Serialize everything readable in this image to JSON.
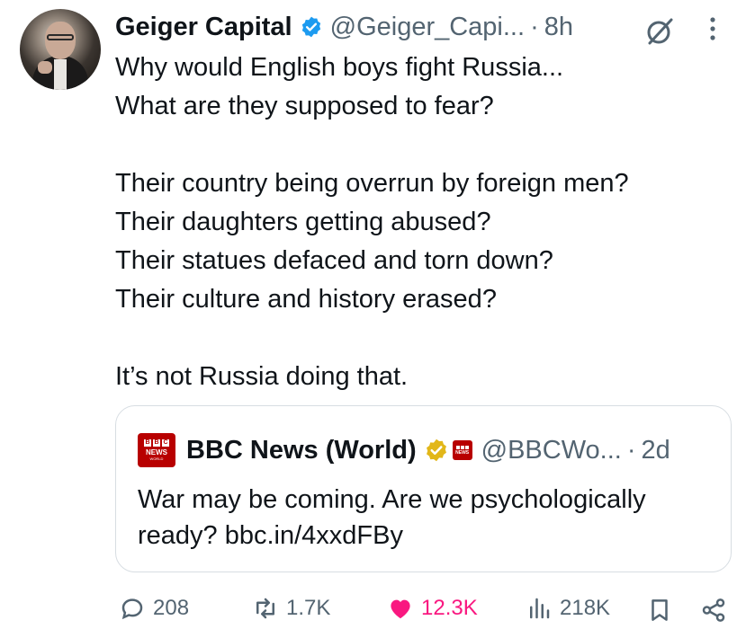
{
  "author": {
    "display_name": "Geiger Capital",
    "handle": "@Geiger_Capi...",
    "separator": "·",
    "time": "8h",
    "avatar_icon": "portrait-avatar",
    "verified_color": "#1d9bf0"
  },
  "tweet": {
    "lines": [
      "Why would English boys fight Russia...",
      "What are they supposed to fear?",
      "",
      "Their country being overrun by foreign men?",
      "Their daughters getting abused?",
      "Their statues defaced and torn down?",
      "Their culture and history erased?",
      "",
      "It’s not Russia doing that."
    ]
  },
  "quote": {
    "logo": {
      "blocks": [
        "B",
        "B",
        "C"
      ],
      "news": "NEWS",
      "world": "WORLD"
    },
    "display_name": "BBC News (World)",
    "handle": "@BBCWo...",
    "separator": "·",
    "time": "2d",
    "text": "War may be coming. Are we psychologically ready? bbc.in/4xxdFBy",
    "badge_color": "#e2b719",
    "brand_color": "#b80000"
  },
  "actions": {
    "replies": "208",
    "reposts": "1.7K",
    "likes": "12.3K",
    "views": "218K",
    "like_color": "#f91880",
    "icon_color": "#536471"
  },
  "icons": {
    "grok": "grok-icon",
    "more": "more-icon",
    "reply": "reply-icon",
    "repost": "repost-icon",
    "like": "heart-icon",
    "views": "views-icon",
    "bookmark": "bookmark-icon",
    "share": "share-icon"
  }
}
